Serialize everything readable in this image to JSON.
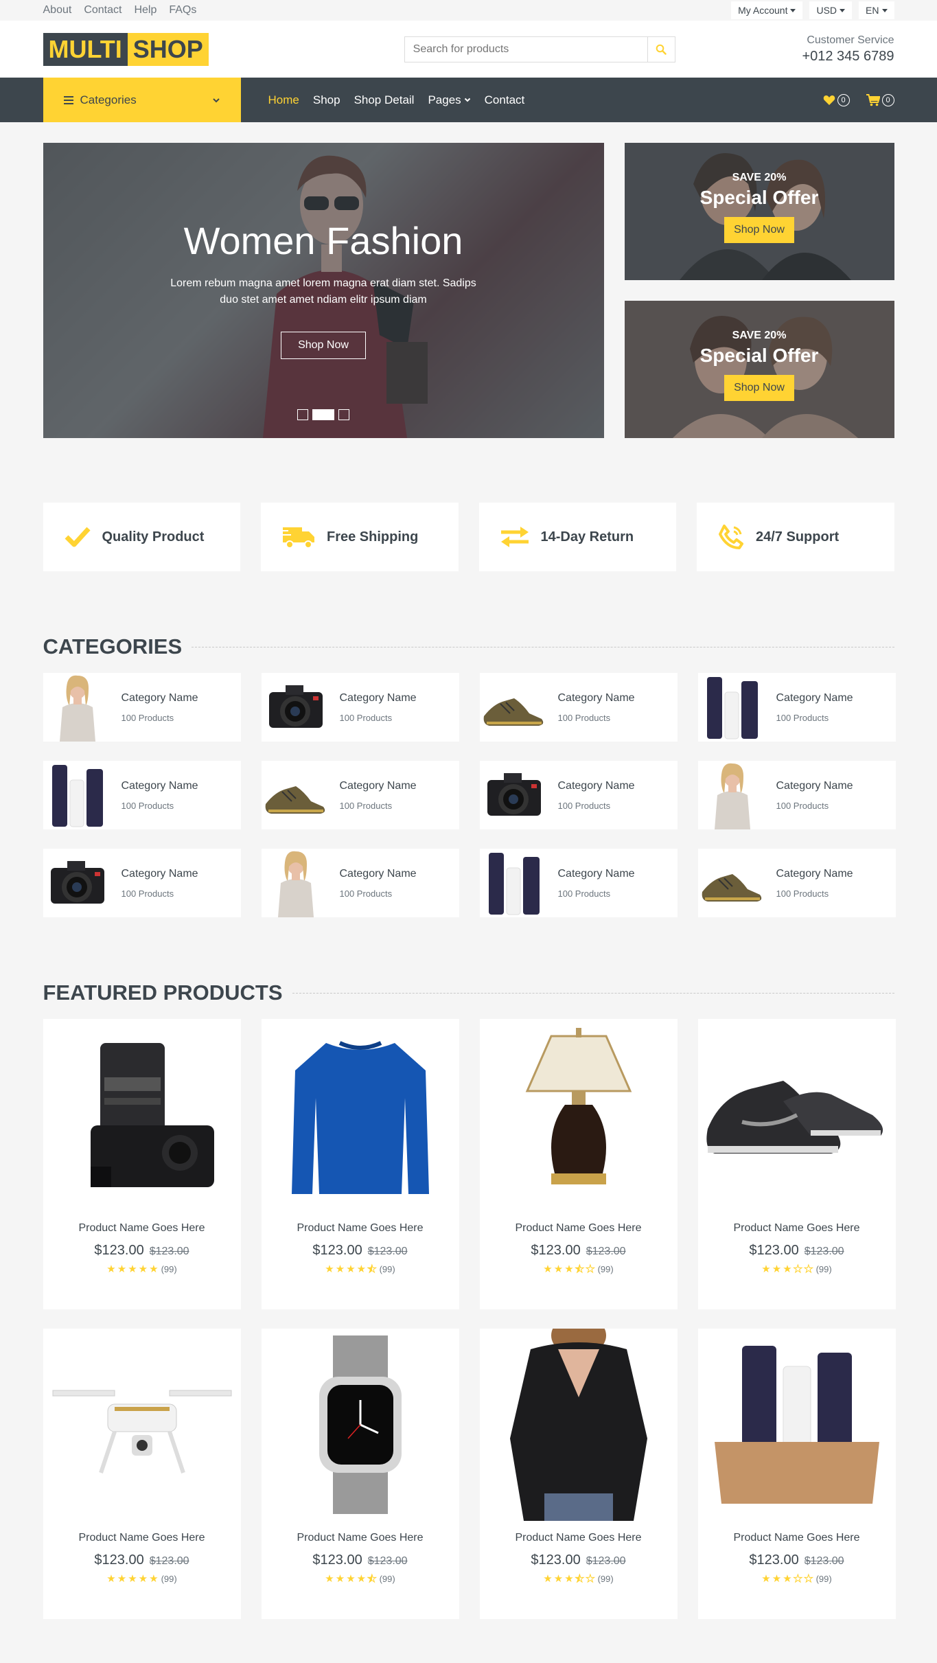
{
  "topbar": {
    "links": [
      "About",
      "Contact",
      "Help",
      "FAQs"
    ],
    "account": "My Account",
    "currency": "USD",
    "language": "EN"
  },
  "header": {
    "logo_part1": "MULTI",
    "logo_part2": "SHOP",
    "search_placeholder": "Search for products",
    "service_label": "Customer Service",
    "service_phone": "+012 345 6789"
  },
  "nav": {
    "categories_label": "Categories",
    "items": [
      "Home",
      "Shop",
      "Shop Detail",
      "Pages",
      "Contact"
    ],
    "wishlist_count": "0",
    "cart_count": "0"
  },
  "hero": {
    "title": "Women Fashion",
    "text": "Lorem rebum magna amet lorem magna erat diam stet. Sadips duo stet amet amet ndiam elitr ipsum diam",
    "button": "Shop Now",
    "active_slide": 2,
    "slides": 3
  },
  "offers": [
    {
      "save": "SAVE 20%",
      "title": "Special Offer",
      "button": "Shop Now"
    },
    {
      "save": "SAVE 20%",
      "title": "Special Offer",
      "button": "Shop Now"
    }
  ],
  "features": [
    {
      "label": "Quality Product",
      "icon": "check-icon"
    },
    {
      "label": "Free Shipping",
      "icon": "truck-icon"
    },
    {
      "label": "14-Day Return",
      "icon": "exchange-icon"
    },
    {
      "label": "24/7 Support",
      "icon": "phone-icon"
    }
  ],
  "categories": {
    "title": "CATEGORIES",
    "items": [
      {
        "name": "Category Name",
        "count": "100 Products",
        "image": "woman"
      },
      {
        "name": "Category Name",
        "count": "100 Products",
        "image": "camera"
      },
      {
        "name": "Category Name",
        "count": "100 Products",
        "image": "shoes"
      },
      {
        "name": "Category Name",
        "count": "100 Products",
        "image": "cosmetics"
      },
      {
        "name": "Category Name",
        "count": "100 Products",
        "image": "cosmetics"
      },
      {
        "name": "Category Name",
        "count": "100 Products",
        "image": "shoes"
      },
      {
        "name": "Category Name",
        "count": "100 Products",
        "image": "camera"
      },
      {
        "name": "Category Name",
        "count": "100 Products",
        "image": "woman"
      },
      {
        "name": "Category Name",
        "count": "100 Products",
        "image": "camera"
      },
      {
        "name": "Category Name",
        "count": "100 Products",
        "image": "woman"
      },
      {
        "name": "Category Name",
        "count": "100 Products",
        "image": "cosmetics"
      },
      {
        "name": "Category Name",
        "count": "100 Products",
        "image": "shoes"
      }
    ]
  },
  "featured": {
    "title": "FEATURED PRODUCTS",
    "items": [
      {
        "name": "Product Name Goes Here",
        "price": "$123.00",
        "old_price": "$123.00",
        "rating": 5,
        "reviews": "(99)",
        "image": "camera"
      },
      {
        "name": "Product Name Goes Here",
        "price": "$123.00",
        "old_price": "$123.00",
        "rating": 4.5,
        "reviews": "(99)",
        "image": "sweater"
      },
      {
        "name": "Product Name Goes Here",
        "price": "$123.00",
        "old_price": "$123.00",
        "rating": 3.5,
        "reviews": "(99)",
        "image": "lamp"
      },
      {
        "name": "Product Name Goes Here",
        "price": "$123.00",
        "old_price": "$123.00",
        "rating": 3,
        "reviews": "(99)",
        "image": "sneakers"
      },
      {
        "name": "Product Name Goes Here",
        "price": "$123.00",
        "old_price": "$123.00",
        "rating": 5,
        "reviews": "(99)",
        "image": "drone"
      },
      {
        "name": "Product Name Goes Here",
        "price": "$123.00",
        "old_price": "$123.00",
        "rating": 4.5,
        "reviews": "(99)",
        "image": "watch"
      },
      {
        "name": "Product Name Goes Here",
        "price": "$123.00",
        "old_price": "$123.00",
        "rating": 3.5,
        "reviews": "(99)",
        "image": "blouse"
      },
      {
        "name": "Product Name Goes Here",
        "price": "$123.00",
        "old_price": "$123.00",
        "rating": 3,
        "reviews": "(99)",
        "image": "cosmetics-box"
      }
    ]
  },
  "colors": {
    "accent": "#ffd333",
    "dark": "#3d464d",
    "bg": "#f5f5f5"
  }
}
